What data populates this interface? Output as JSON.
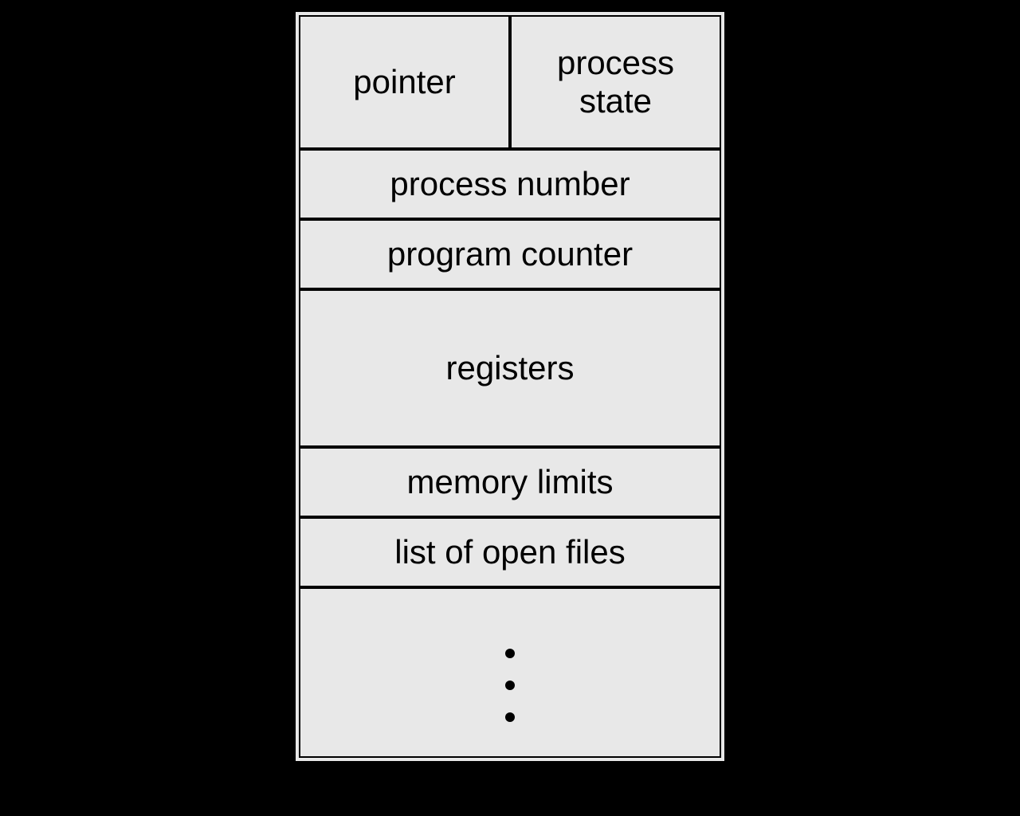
{
  "pcb": {
    "pointer": "pointer",
    "process_state": "process\nstate",
    "process_number": "process number",
    "program_counter": "program counter",
    "registers": "registers",
    "memory_limits": "memory limits",
    "list_of_open_files": "list of open files"
  }
}
